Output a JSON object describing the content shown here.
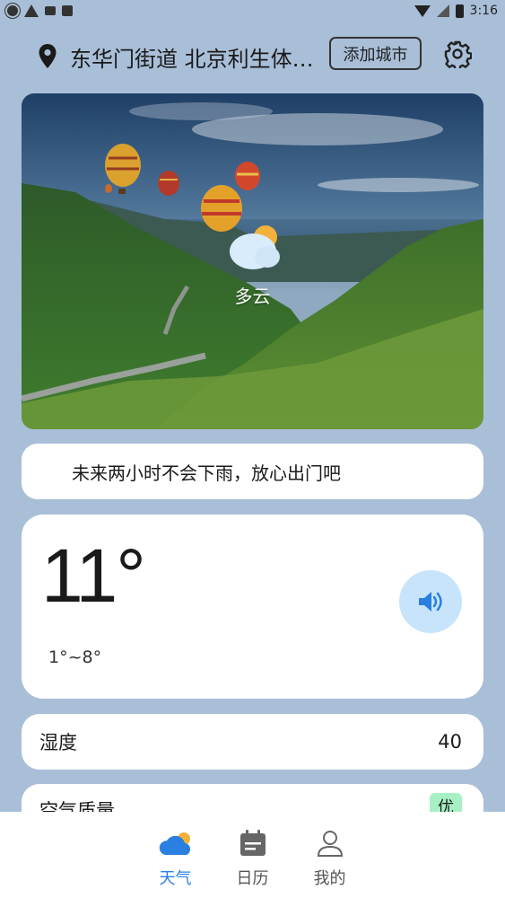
{
  "status_bar": {
    "time": "3:16",
    "left_icons": [
      "sun-icon",
      "warning-icon",
      "mail-icon",
      "a-badge-icon"
    ],
    "right_icons": [
      "wifi-icon",
      "signal-icon",
      "battery-icon"
    ]
  },
  "header": {
    "location": "东华门街道 北京利生体…",
    "add_city_label": "添加城市",
    "location_icon": "pin-icon",
    "settings_icon": "gear-icon"
  },
  "hero": {
    "condition": "多云",
    "condition_icon": "partly-cloudy-icon"
  },
  "tip": {
    "text": "未来两小时不会下雨，放心出门吧"
  },
  "temperature": {
    "current": "11°",
    "range": "1°~8°",
    "speaker_icon": "speaker-icon"
  },
  "humidity": {
    "label": "湿度",
    "value": "40"
  },
  "air_quality": {
    "label": "空气质量",
    "badge": "优",
    "badge_color": "#a6f0c3"
  },
  "nav": {
    "items": [
      {
        "label": "天气",
        "icon": "weather-icon",
        "active": true
      },
      {
        "label": "日历",
        "icon": "calendar-icon",
        "active": false
      },
      {
        "label": "我的",
        "icon": "profile-icon",
        "active": false
      }
    ],
    "active_color": "#2b7fe0"
  },
  "colors": {
    "background": "#a9bfd8",
    "accent": "#2b7fe0",
    "speaker_bg": "#c7e4fb"
  }
}
